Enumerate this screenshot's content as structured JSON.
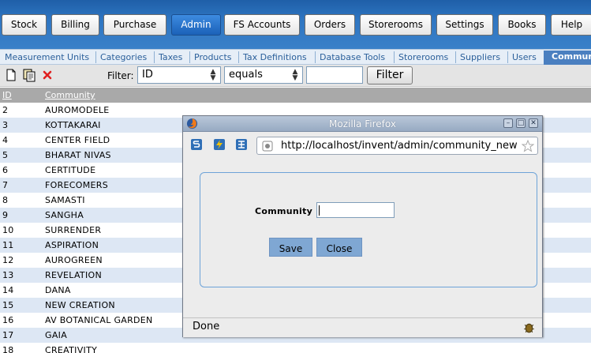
{
  "top_nav": {
    "items": [
      {
        "label": "Stock"
      },
      {
        "label": "Billing"
      },
      {
        "label": "Purchase"
      },
      {
        "label": "Admin",
        "active": true
      },
      {
        "label": "FS Accounts"
      },
      {
        "label": "Orders"
      },
      {
        "label": "Storerooms"
      },
      {
        "label": "Settings"
      },
      {
        "label": "Books"
      },
      {
        "label": "Help"
      }
    ]
  },
  "sub_nav": {
    "items": [
      {
        "label": "Measurement Units"
      },
      {
        "label": "Categories"
      },
      {
        "label": "Taxes"
      },
      {
        "label": "Products"
      },
      {
        "label": "Tax Definitions"
      },
      {
        "label": "Database Tools"
      },
      {
        "label": "Storerooms"
      },
      {
        "label": "Suppliers"
      },
      {
        "label": "Users"
      },
      {
        "label": "Commun",
        "active": true
      }
    ]
  },
  "toolbar": {
    "icons": [
      "new-document-icon",
      "copy-icon",
      "delete-icon"
    ],
    "filter_label": "Filter:",
    "field_select": "ID",
    "operator_select": "equals",
    "filter_value": "",
    "filter_button": "Filter"
  },
  "table": {
    "headers": [
      "ID",
      "Community"
    ],
    "rows": [
      {
        "id": "2",
        "name": "AUROMODELE"
      },
      {
        "id": "3",
        "name": "KOTTAKARAI"
      },
      {
        "id": "4",
        "name": "CENTER FIELD"
      },
      {
        "id": "5",
        "name": "BHARAT NIVAS"
      },
      {
        "id": "6",
        "name": "CERTITUDE"
      },
      {
        "id": "7",
        "name": "FORECOMERS"
      },
      {
        "id": "8",
        "name": "SAMASTI"
      },
      {
        "id": "9",
        "name": "SANGHA"
      },
      {
        "id": "10",
        "name": "SURRENDER"
      },
      {
        "id": "11",
        "name": "ASPIRATION"
      },
      {
        "id": "12",
        "name": "AUROGREEN"
      },
      {
        "id": "13",
        "name": "REVELATION"
      },
      {
        "id": "14",
        "name": "DANA"
      },
      {
        "id": "15",
        "name": "NEW CREATION"
      },
      {
        "id": "16",
        "name": "AV BOTANICAL GARDEN"
      },
      {
        "id": "17",
        "name": "GAIA"
      },
      {
        "id": "18",
        "name": "CREATIVITY"
      }
    ]
  },
  "popup": {
    "title": "Mozilla Firefox",
    "url": "http://localhost/invent/admin/community_new",
    "nav_icons": [
      "s-icon",
      "bolt-icon",
      "grid-icon"
    ],
    "form": {
      "field_label": "Community",
      "field_value": "",
      "save_label": "Save",
      "close_label": "Close"
    },
    "status_text": "Done"
  },
  "colors": {
    "nav_blue": "#2f76c2",
    "active_tab": "#1b61b8",
    "row_alt": "#dde7f4",
    "header_gray": "#a9a9a9",
    "dialog_button": "#7fa7d3"
  }
}
